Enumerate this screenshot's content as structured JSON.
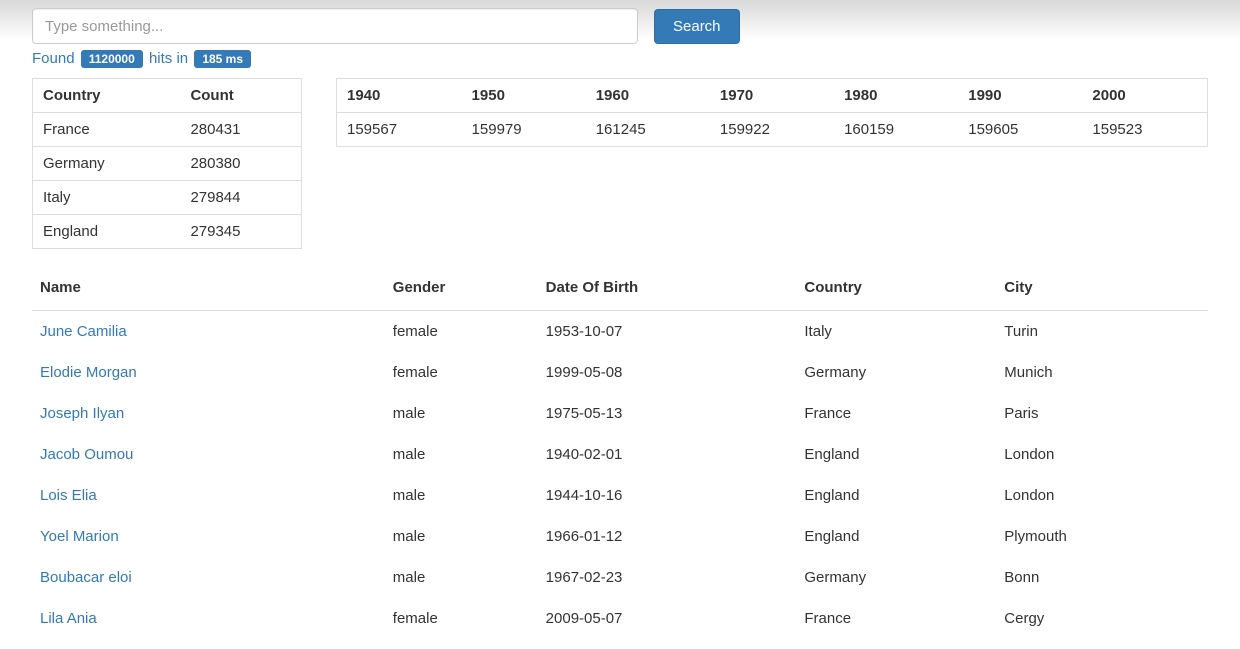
{
  "search": {
    "placeholder": "Type something...",
    "button_label": "Search"
  },
  "stats": {
    "found_label": "Found",
    "hits_count": "1120000",
    "hits_label": "hits in",
    "time": "185 ms"
  },
  "facets": {
    "headers": [
      "Country",
      "Count"
    ],
    "rows": [
      {
        "country": "France",
        "count": "280431"
      },
      {
        "country": "Germany",
        "count": "280380"
      },
      {
        "country": "Italy",
        "count": "279844"
      },
      {
        "country": "England",
        "count": "279345"
      }
    ]
  },
  "decades": {
    "headers": [
      "1940",
      "1950",
      "1960",
      "1970",
      "1980",
      "1990",
      "2000"
    ],
    "rows": [
      [
        "159567",
        "159979",
        "161245",
        "159922",
        "160159",
        "159605",
        "159523"
      ]
    ]
  },
  "results": {
    "headers": [
      "Name",
      "Gender",
      "Date Of Birth",
      "Country",
      "City"
    ],
    "rows": [
      {
        "name": "June Camilia",
        "gender": "female",
        "dob": "1953-10-07",
        "country": "Italy",
        "city": "Turin"
      },
      {
        "name": "Elodie Morgan",
        "gender": "female",
        "dob": "1999-05-08",
        "country": "Germany",
        "city": "Munich"
      },
      {
        "name": "Joseph Ilyan",
        "gender": "male",
        "dob": "1975-05-13",
        "country": "France",
        "city": "Paris"
      },
      {
        "name": "Jacob Oumou",
        "gender": "male",
        "dob": "1940-02-01",
        "country": "England",
        "city": "London"
      },
      {
        "name": "Lois Elia",
        "gender": "male",
        "dob": "1944-10-16",
        "country": "England",
        "city": "London"
      },
      {
        "name": "Yoel Marion",
        "gender": "male",
        "dob": "1966-01-12",
        "country": "England",
        "city": "Plymouth"
      },
      {
        "name": "Boubacar eloi",
        "gender": "male",
        "dob": "1967-02-23",
        "country": "Germany",
        "city": "Bonn"
      },
      {
        "name": "Lila Ania",
        "gender": "female",
        "dob": "2009-05-07",
        "country": "France",
        "city": "Cergy"
      }
    ]
  }
}
